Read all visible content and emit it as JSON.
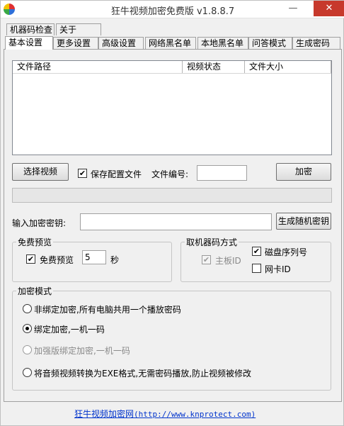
{
  "window": {
    "title": "狂牛视频加密免费版 v1.8.8.7",
    "minimize_glyph": "—",
    "close_glyph": "✕",
    "icon": "app-logo-icon"
  },
  "tabs_row_top": [
    {
      "label": "机器码检查"
    },
    {
      "label": "关于"
    }
  ],
  "tabs_row_bottom": [
    {
      "label": "基本设置",
      "active": true
    },
    {
      "label": "更多设置"
    },
    {
      "label": "高级设置"
    },
    {
      "label": "网络黑名单"
    },
    {
      "label": "本地黑名单"
    },
    {
      "label": "问答模式"
    },
    {
      "label": "生成密码"
    }
  ],
  "file_list": {
    "columns": [
      "文件路径",
      "视频状态",
      "文件大小"
    ]
  },
  "actions": {
    "select_video": "选择视频",
    "save_config": "保存配置文件",
    "save_config_checked": true,
    "file_number_label": "文件编号:",
    "file_number_value": "",
    "encrypt": "加密"
  },
  "progress": {
    "value": 0
  },
  "key": {
    "label": "输入加密密钥:",
    "value": "",
    "generate_button": "生成随机密钥"
  },
  "preview": {
    "group_title": "免费预览",
    "checkbox_label": "免费预览",
    "checked": true,
    "seconds_value": "5",
    "seconds_unit": "秒"
  },
  "machine_code": {
    "group_title": "取机器码方式",
    "options": [
      {
        "label": "主板ID",
        "checked": true,
        "disabled": true
      },
      {
        "label": "磁盘序列号",
        "checked": true,
        "disabled": false
      },
      {
        "label": "网卡ID",
        "checked": false,
        "disabled": false
      }
    ]
  },
  "encrypt_mode": {
    "group_title": "加密模式",
    "options": [
      {
        "label": "非绑定加密,所有电脑共用一个播放密码",
        "checked": false,
        "disabled": false
      },
      {
        "label": "绑定加密,一机一码",
        "checked": true,
        "disabled": false
      },
      {
        "label": "加强版绑定加密,一机一码",
        "checked": false,
        "disabled": true
      },
      {
        "label": "将音频视频转换为EXE格式,无需密码播放,防止视频被修改",
        "checked": false,
        "disabled": false
      }
    ]
  },
  "footer": {
    "site_name": "狂牛视频加密网",
    "url_text": "(http://www.knprotect.com)"
  },
  "colors": {
    "link": "#0033cc",
    "close_button": "#c7392c"
  }
}
